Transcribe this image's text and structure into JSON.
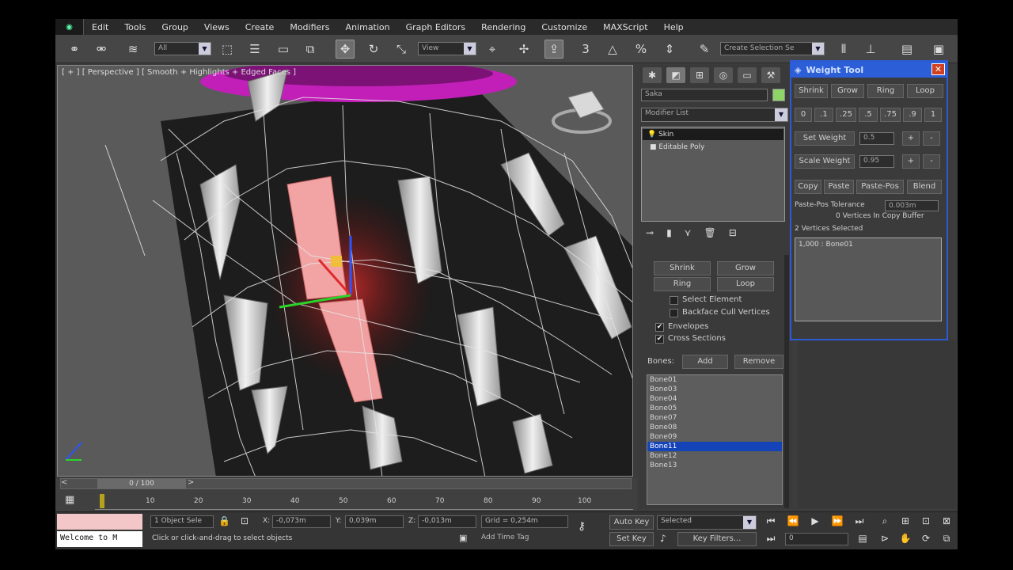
{
  "menu": [
    "Edit",
    "Tools",
    "Group",
    "Views",
    "Create",
    "Modifiers",
    "Animation",
    "Graph Editors",
    "Rendering",
    "Customize",
    "MAXScript",
    "Help"
  ],
  "toolbar": {
    "filter_value": "All",
    "refcoord_value": "View",
    "selection_set_placeholder": "Create Selection Se"
  },
  "viewport": {
    "label": "[ + ] [ Perspective ] [ Smooth + Highlights + Edged Faces ]"
  },
  "command_panel": {
    "object_name": "Saka",
    "modifier_list_label": "Modifier List",
    "stack": [
      {
        "label": "Skin",
        "selected": true
      },
      {
        "label": "Editable Poly",
        "selected": false
      }
    ],
    "shrink_label": "Shrink",
    "grow_label": "Grow",
    "ring_label": "Ring",
    "loop_label": "Loop",
    "select_element_label": "Select Element",
    "backface_cull_label": "Backface Cull Vertices",
    "envelopes_label": "Envelopes",
    "cross_sections_label": "Cross Sections",
    "bones_label": "Bones:",
    "add_label": "Add",
    "remove_label": "Remove",
    "bones": [
      "Bone01",
      "Bone03",
      "Bone04",
      "Bone05",
      "Bone07",
      "Bone08",
      "Bone09",
      "Bone11",
      "Bone12",
      "Bone13"
    ],
    "selected_bone": "Bone11"
  },
  "weight_tool": {
    "title": "Weight Tool",
    "row1": [
      "Shrink",
      "Grow",
      "Ring",
      "Loop"
    ],
    "presets": [
      "0",
      ".1",
      ".25",
      ".5",
      ".75",
      ".9",
      "1"
    ],
    "set_weight_label": "Set Weight",
    "set_weight_value": "0.5",
    "scale_weight_label": "Scale Weight",
    "scale_weight_value": "0.95",
    "plus": "+",
    "minus": "-",
    "row_copy": [
      "Copy",
      "Paste",
      "Paste-Pos",
      "Blend"
    ],
    "tolerance_label": "Paste-Pos Tolerance",
    "tolerance_value": "0.003m",
    "copy_buffer_text": "0 Vertices In Copy Buffer",
    "selected_text": "2 Vertices Selected",
    "weights_list": [
      "1,000 : Bone01"
    ]
  },
  "timeline": {
    "frame_display": "0 / 100",
    "ticks": [
      "10",
      "20",
      "30",
      "40",
      "50",
      "60",
      "70",
      "80",
      "90",
      "100"
    ]
  },
  "status": {
    "maxscript_text": "Welcome to M",
    "selection_text": "1 Object Sele",
    "x_label": "X:",
    "x_value": "-0,073m",
    "y_label": "Y:",
    "y_value": "0,039m",
    "z_label": "Z:",
    "z_value": "-0,013m",
    "grid_text": "Grid = 0,254m",
    "prompt_text": "Click or click-and-drag to select objects",
    "add_time_tag": "Add Time Tag",
    "auto_key": "Auto Key",
    "set_key": "Set Key",
    "key_mode_value": "Selected",
    "key_filters": "Key Filters...",
    "frame_value": "0"
  },
  "colors": {
    "accent": "#2c5ed8",
    "selection": "#1543b8",
    "object_color": "#8fd468",
    "magenta_ring": "#c21fb9"
  }
}
